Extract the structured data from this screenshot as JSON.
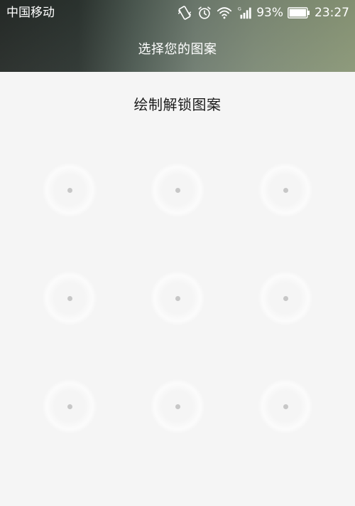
{
  "status_bar": {
    "carrier": "中国移动",
    "battery_percent": "93%",
    "time": "23:27",
    "icons": [
      "vibrate-icon",
      "alarm-icon",
      "wifi-icon",
      "signal-icon",
      "battery-icon"
    ],
    "signal_network": "G"
  },
  "header": {
    "title": "选择您的图案"
  },
  "main": {
    "instruction": "绘制解锁图案",
    "pattern_dots": 9
  },
  "colors": {
    "header_gradient_start": "#262b28",
    "header_gradient_end": "#8a9777",
    "background": "#f5f5f5",
    "dot": "#c7c7c7",
    "text": "#1a1a1a"
  }
}
